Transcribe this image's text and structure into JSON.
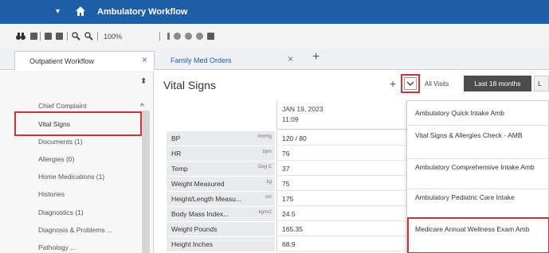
{
  "window": {
    "title": "Ambulatory Workflow"
  },
  "toolbar": {
    "zoom": "100%"
  },
  "tabs": [
    {
      "label": "Outpatient Workflow",
      "active": true
    },
    {
      "label": "Family Med Orders",
      "active": false
    }
  ],
  "icons": {
    "add_tab": "+",
    "close": "×",
    "pin": "⬍",
    "collapse": "^",
    "add_component": "+",
    "caret": "▾"
  },
  "sidebar": {
    "items": [
      {
        "label": "Chief Complaint"
      },
      {
        "label": "Vital Signs",
        "selected": true
      },
      {
        "label": "Documents (1)"
      },
      {
        "label": "Allergies (0)"
      },
      {
        "label": "Home Medications (1)"
      },
      {
        "label": "Histories"
      },
      {
        "label": "Diagnostics (1)"
      },
      {
        "label": "Diagnosis & Problems ..."
      },
      {
        "label": "Pathology ..."
      }
    ]
  },
  "main": {
    "title": "Vital Signs",
    "filter_label": "All Visits",
    "range_selected": "Last 18 months",
    "range_next": "L",
    "column_date": "JAN 19, 2023",
    "column_time": "11:09",
    "rows": [
      {
        "label": "BP",
        "unit": "mmHg",
        "value": "120 / 80"
      },
      {
        "label": "HR",
        "unit": "bpm",
        "value": "76"
      },
      {
        "label": "Temp",
        "unit": "Deg C",
        "value": "37"
      },
      {
        "label": "Weight Measured",
        "unit": "kg",
        "value": "75"
      },
      {
        "label": "Height/Length Measu...",
        "unit": "cm",
        "value": "175"
      },
      {
        "label": "Body Mass Index...",
        "unit": "kg/m2",
        "value": "24.5"
      },
      {
        "label": "Weight Pounds",
        "unit": "",
        "value": "165.35"
      },
      {
        "label": "Height Inches",
        "unit": "",
        "value": "68.9"
      }
    ]
  },
  "dropdown": {
    "items": [
      {
        "label": "Ambulatory Quick Intake Amb"
      },
      {
        "label": "Vital Signs & Allergies Check - AMB"
      },
      {
        "label": "Ambulatory Comprehensive Intake Amb"
      },
      {
        "label": "Ambulatory Pediatric Care Intake"
      },
      {
        "label": "Medicare Annual Wellness Exam Amb",
        "highlighted": true
      }
    ]
  },
  "colors": {
    "header_blue": "#1d5ea8",
    "highlight_red": "#d6303b",
    "active_dark": "#4c4c4c"
  }
}
